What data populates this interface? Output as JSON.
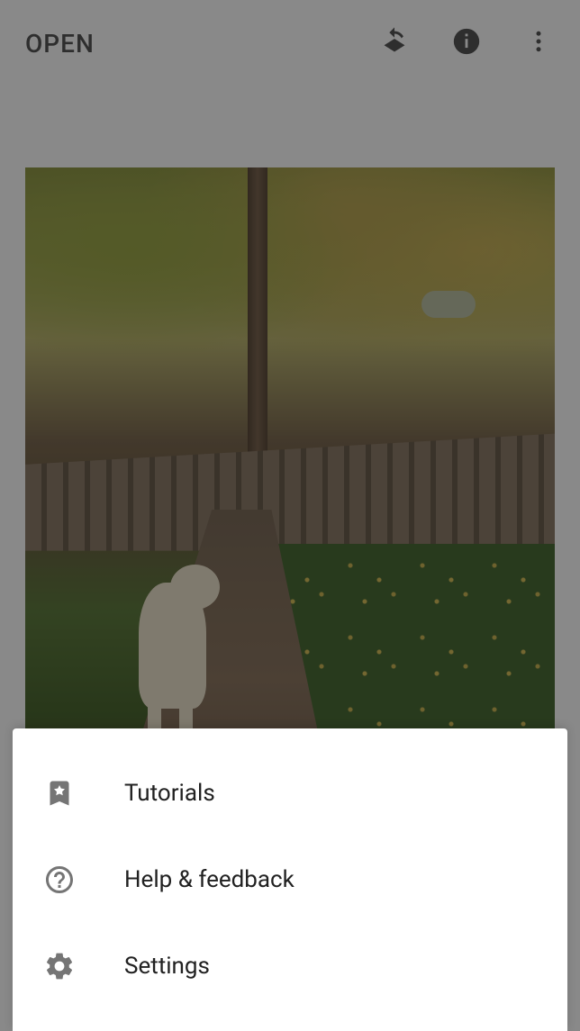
{
  "header": {
    "open_label": "OPEN"
  },
  "menu": {
    "items": [
      {
        "label": "Tutorials",
        "icon": "star-bookmark-icon"
      },
      {
        "label": "Help & feedback",
        "icon": "help-icon"
      },
      {
        "label": "Settings",
        "icon": "gear-icon"
      }
    ]
  }
}
